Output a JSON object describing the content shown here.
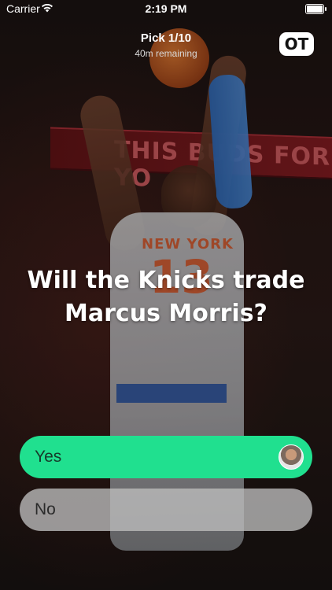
{
  "status_bar": {
    "carrier": "Carrier",
    "time": "2:19 PM"
  },
  "header": {
    "pick": "Pick 1/10",
    "remaining": "40m remaining",
    "logo_icon": "ot-logo-icon"
  },
  "question": "Will the Knicks trade Marcus Morris?",
  "background": {
    "banner_text": "THIS BUDS FOR YO",
    "jersey_team": "NEW YORK",
    "jersey_number": "13"
  },
  "answers": [
    {
      "label": "Yes",
      "selected": true,
      "color": "#20e08f"
    },
    {
      "label": "No",
      "selected": false
    }
  ]
}
